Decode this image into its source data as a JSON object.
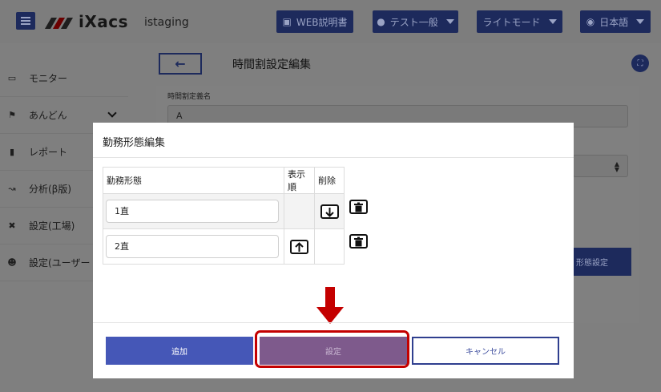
{
  "header": {
    "brand": "iXacs",
    "environment": "istaging",
    "manual_label": "WEB説明書",
    "user_label": "テスト一般",
    "theme_label": "ライトモード",
    "language_label": "日本語"
  },
  "sidebar": {
    "items": [
      {
        "label": "モニター",
        "icon": "monitor-icon"
      },
      {
        "label": "あんどん",
        "icon": "flag-icon"
      },
      {
        "label": "レポート",
        "icon": "document-icon"
      },
      {
        "label": "分析(β版)",
        "icon": "chart-icon"
      },
      {
        "label": "設定(工場)",
        "icon": "tools-icon"
      },
      {
        "label": "設定(ユーザー",
        "icon": "users-icon"
      }
    ]
  },
  "page": {
    "title": "時間割設定編集",
    "field_label": "時間割定義名",
    "field_value": "A",
    "side_button_label": "形態設定"
  },
  "modal": {
    "title": "勤務形態編集",
    "columns": [
      "勤務形態",
      "表示順",
      "削除"
    ],
    "rows": [
      {
        "name": "1直"
      },
      {
        "name": "2直"
      }
    ],
    "add_label": "追加",
    "set_label": "設定",
    "cancel_label": "キャンセル"
  },
  "colors": {
    "primary": "#4557b7",
    "highlight": "#c40000"
  }
}
